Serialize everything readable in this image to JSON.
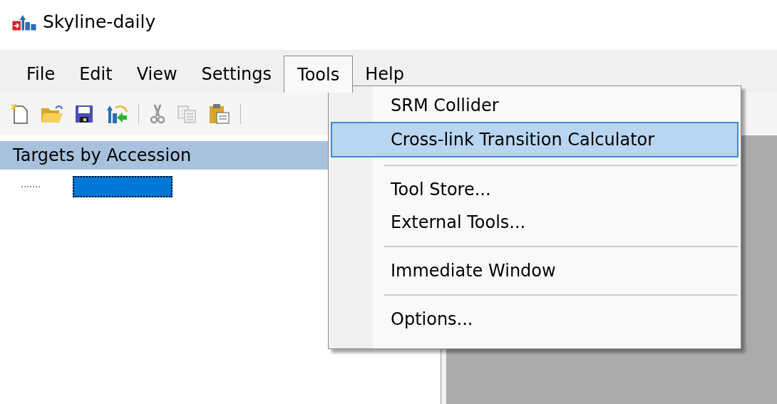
{
  "window": {
    "title": "Skyline-daily"
  },
  "menu_bar": [
    {
      "label": "File",
      "selected": false
    },
    {
      "label": "Edit",
      "selected": false
    },
    {
      "label": "View",
      "selected": false
    },
    {
      "label": "Settings",
      "selected": false
    },
    {
      "label": "Tools",
      "selected": true
    },
    {
      "label": "Help",
      "selected": false
    }
  ],
  "tools_menu": [
    {
      "kind": "item",
      "label": "SRM Collider",
      "selected": false
    },
    {
      "kind": "item",
      "label": "Cross-link Transition Calculator",
      "selected": true
    },
    {
      "kind": "separator"
    },
    {
      "kind": "item",
      "label": "Tool Store...",
      "selected": false
    },
    {
      "kind": "item",
      "label": "External Tools...",
      "selected": false
    },
    {
      "kind": "separator"
    },
    {
      "kind": "item",
      "label": "Immediate Window",
      "selected": false
    },
    {
      "kind": "separator"
    },
    {
      "kind": "item",
      "label": "Options...",
      "selected": false
    }
  ],
  "targets_panel": {
    "title": "Targets by Accession",
    "tree": [
      {
        "selected": true
      }
    ]
  }
}
